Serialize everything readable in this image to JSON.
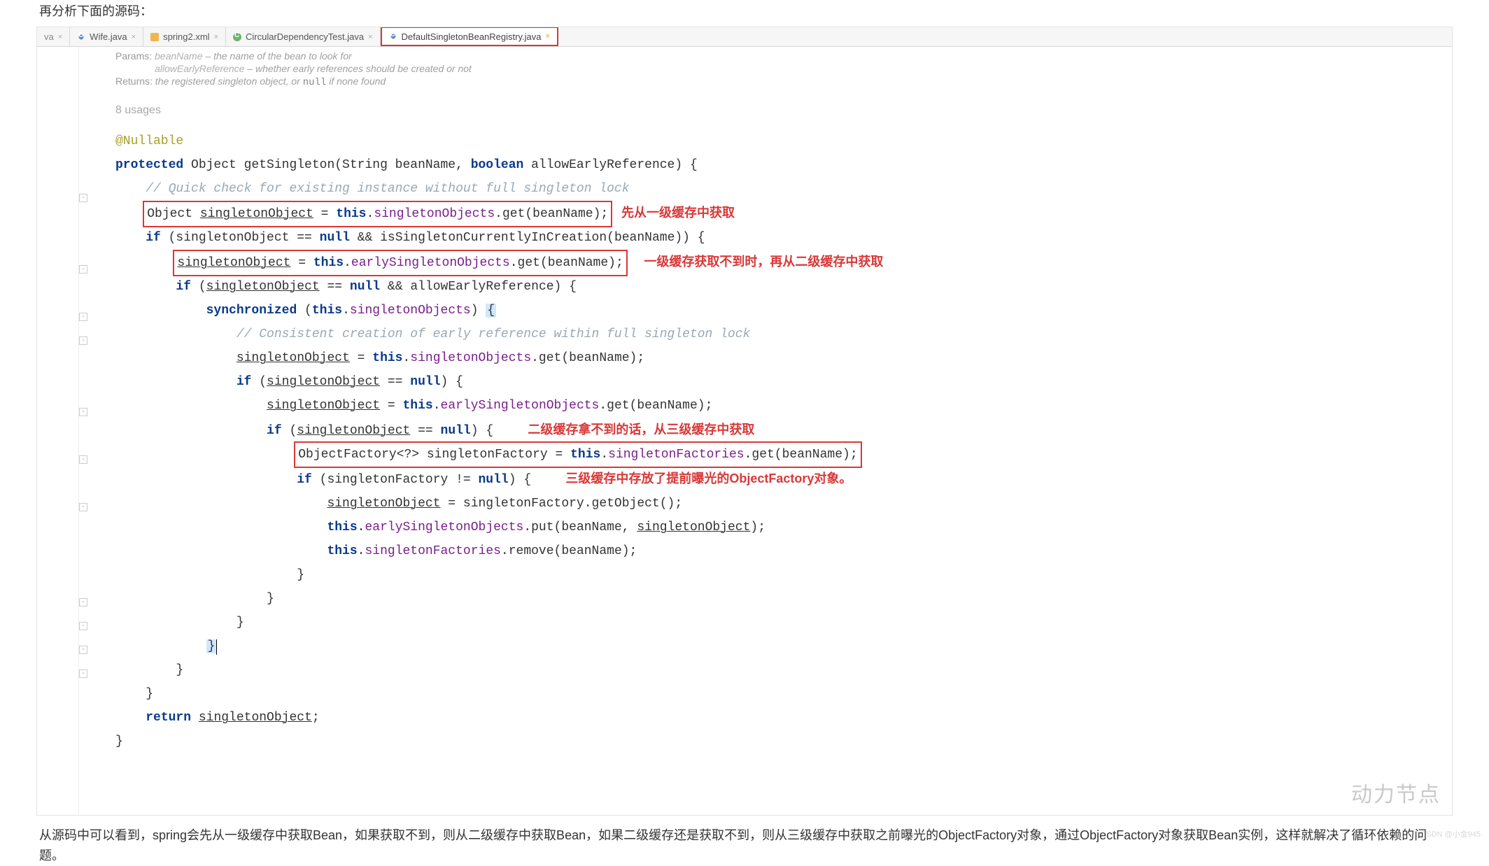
{
  "notes": {
    "top": "再分析下面的源码：",
    "bottom": "从源码中可以看到，spring会先从一级缓存中获取Bean，如果获取不到，则从二级缓存中获取Bean，如果二级缓存还是获取不到，则从三级缓存中获取之前曝光的ObjectFactory对象，通过ObjectFactory对象获取Bean实例，这样就解决了循环依赖的问题。"
  },
  "tabs": {
    "t0": "va",
    "t1": "Wife.java",
    "t2": "spring2.xml",
    "t3": "CircularDependencyTest.java",
    "t4": "DefaultSingletonBeanRegistry.java"
  },
  "close": "×",
  "doc": {
    "params_label": "Params:",
    "p1_a": "beanName",
    "p1_b": " – the name of the bean to look for",
    "p2_a": "allowEarlyReference",
    "p2_b": " – whether early references should be created or not",
    "returns_label": "Returns:",
    "returns_a": " the registered singleton object, or ",
    "returns_code": "null",
    "returns_b": " if none found"
  },
  "usages": "8 usages",
  "annotation": "@Nullable",
  "kw": {
    "protected": "protected",
    "boolean": "boolean",
    "if": "if",
    "null": "null",
    "synchronized": "synchronized",
    "this": "this",
    "return": "return"
  },
  "code": {
    "sig_a": " Object getSingleton(String beanName, ",
    "sig_b": " allowEarlyReference) {",
    "c1": "// Quick check for existing instance without full singleton lock",
    "l1_box": "Object singletonObject = this.singletonObjects.get(beanName);",
    "l1_field": "singletonObjects",
    "a1": "先从一级缓存中获取",
    "l2_a": " (singletonObject == ",
    "l2_b": " && isSingletonCurrentlyInCreation(beanName)) {",
    "l3_u": "singletonObject",
    "l3_mid": " = ",
    "l3_field": "earlySingletonObjects",
    "l3_tail": ".get(beanName);",
    "a2": "一级缓存获取不到时，再从二级缓存中获取",
    "l4_a": " (",
    "l4_u": "singletonObject",
    "l4_b": " == ",
    "l4_c": " && allowEarlyReference) {",
    "l5_a": " (",
    "l5_field": "singletonObjects",
    "l5_b": ") ",
    "l5_brace": "{",
    "c2": "// Consistent creation of early reference within full singleton lock",
    "l6_u": "singletonObject",
    "l6_a": " = ",
    "l6_field": "singletonObjects",
    "l6_b": ".get(beanName);",
    "l7_a": " (",
    "l7_u": "singletonObject",
    "l7_b": " == ",
    "l7_c": ") {",
    "l8_u": "singletonObject",
    "l8_a": " = ",
    "l8_field": "earlySingletonObjects",
    "l8_b": ".get(beanName);",
    "l9_a": " (",
    "l9_u": "singletonObject",
    "l9_b": " == ",
    "l9_c": ") {",
    "a3": "二级缓存拿不到的话，从三级缓存中获取",
    "l10_box_a": "ObjectFactory<?> singletonFactory = ",
    "l10_field": "singletonFactories",
    "l10_box_b": ".get(beanName);",
    "l11_a": " (singletonFactory != ",
    "l11_b": ") {",
    "a4": "三级缓存中存放了提前曝光的ObjectFactory对象。",
    "l12_u": "singletonObject",
    "l12_a": " = singletonFactory.getObject();",
    "l13_field": "earlySingletonObjects",
    "l13_a": ".put(beanName, ",
    "l13_u": "singletonObject",
    "l13_b": ");",
    "l14_field": "singletonFactories",
    "l14_a": ".remove(beanName);",
    "rb": "}",
    "ret_u": "singletonObject",
    "ret_b": ";"
  },
  "watermark": "动力节点",
  "sdn": "SDN @小金945"
}
